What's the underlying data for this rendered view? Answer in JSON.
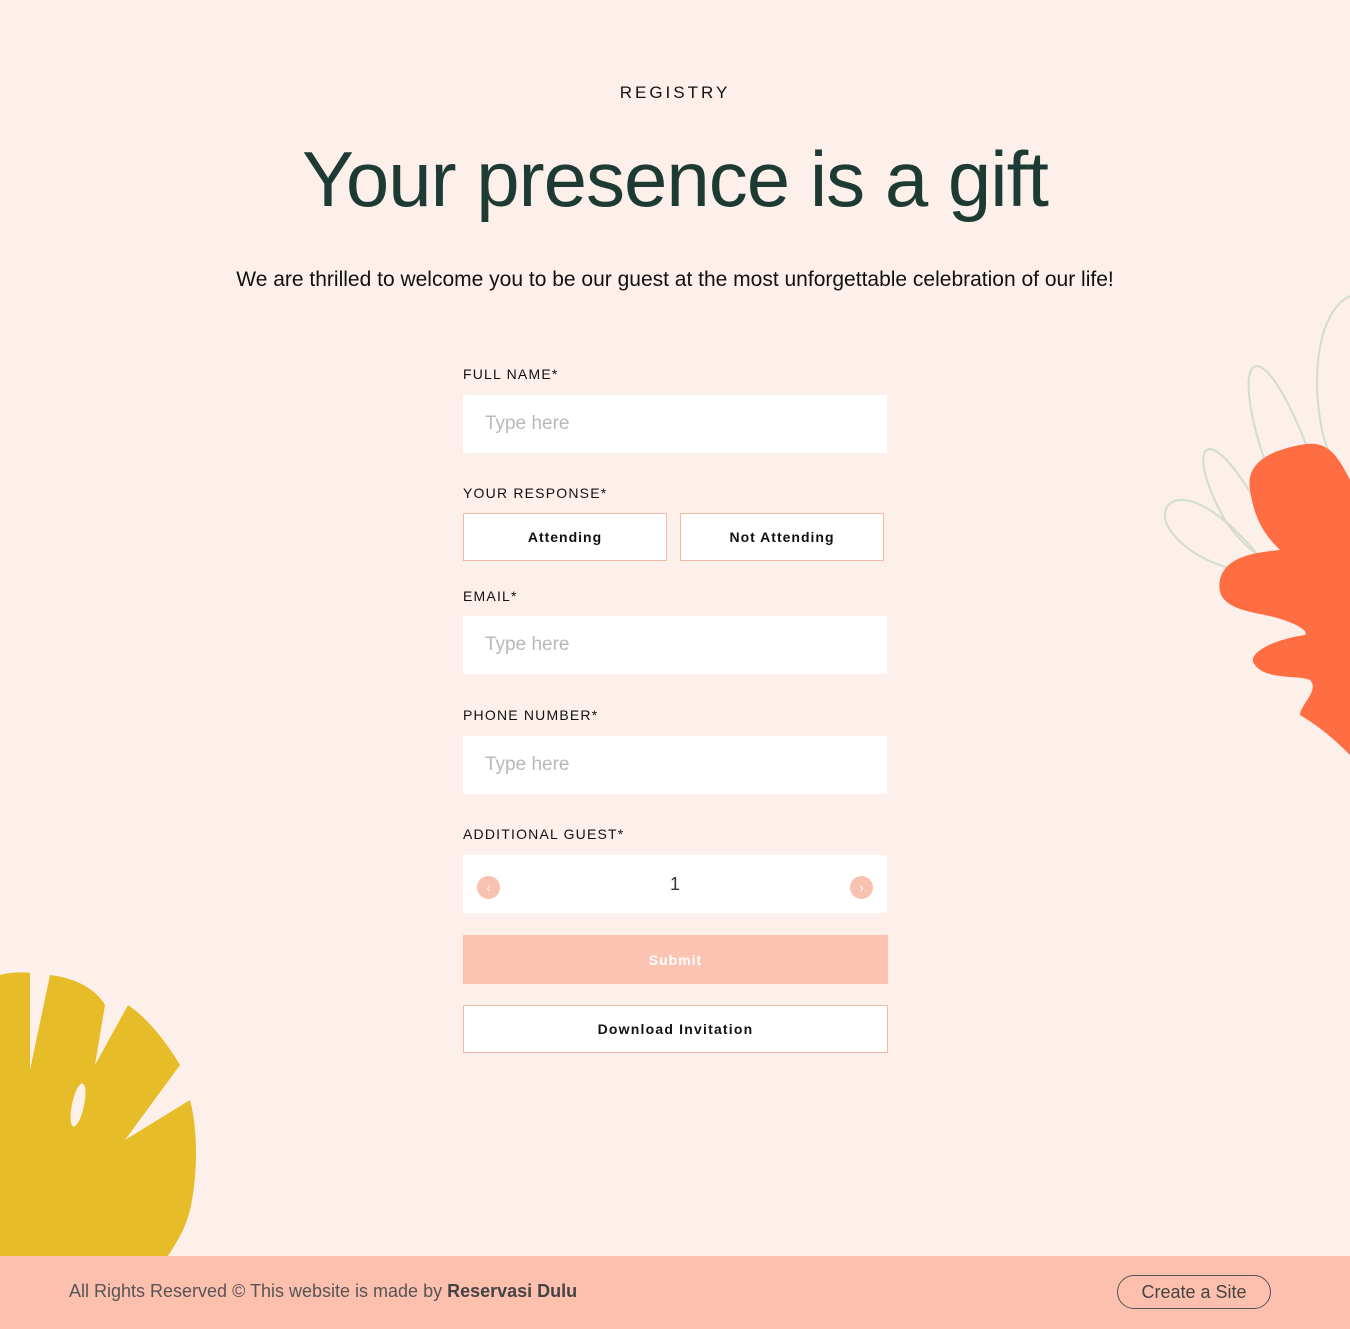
{
  "header": {
    "eyebrow": "REGISTRY",
    "title": "Your presence is a gift",
    "intro": "We are thrilled to welcome you to be our guest at the most unforgettable celebration of our life!"
  },
  "form": {
    "full_name": {
      "label": "FULL NAME*",
      "placeholder": "Type here",
      "value": ""
    },
    "response": {
      "label": "YOUR RESPONSE*",
      "options": [
        "Attending",
        "Not Attending"
      ]
    },
    "email": {
      "label": "EMAIL*",
      "placeholder": "Type here",
      "value": ""
    },
    "phone": {
      "label": "PHONE NUMBER*",
      "placeholder": "Type here",
      "value": ""
    },
    "guests": {
      "label": "ADDITIONAL GUEST*",
      "value": "1",
      "decrement_icon": "chevron-left-icon",
      "increment_icon": "chevron-right-icon"
    },
    "submit_label": "Submit",
    "download_label": "Download Invitation"
  },
  "footer": {
    "text": "All Rights Reserved © This website is made by",
    "brand": "Reservasi Dulu",
    "cta": "Create a Site"
  },
  "colors": {
    "background": "#fdf0eb",
    "headline": "#1d3a33",
    "accent": "#fdc0ae",
    "orange_leaf": "#ff6d42",
    "yellow_leaf": "#e6bd28"
  }
}
